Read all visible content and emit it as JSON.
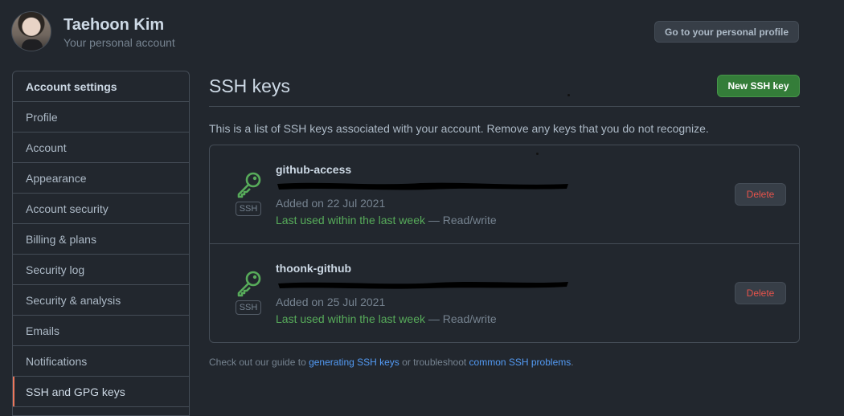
{
  "header": {
    "user_name": "Taehoon Kim",
    "account_label": "Your personal account",
    "profile_button": "Go to your personal profile"
  },
  "sidebar": {
    "items": [
      {
        "label": "Account settings"
      },
      {
        "label": "Profile"
      },
      {
        "label": "Account"
      },
      {
        "label": "Appearance"
      },
      {
        "label": "Account security"
      },
      {
        "label": "Billing & plans"
      },
      {
        "label": "Security log"
      },
      {
        "label": "Security & analysis"
      },
      {
        "label": "Emails"
      },
      {
        "label": "Notifications"
      },
      {
        "label": "SSH and GPG keys"
      }
    ]
  },
  "main": {
    "title": "SSH keys",
    "new_key_button": "New SSH key",
    "intro": "This is a list of SSH keys associated with your account. Remove any keys that you do not recognize.",
    "keys": [
      {
        "badge": "SSH",
        "title": "github-access",
        "added": "Added on 22 Jul 2021",
        "last_used": "Last used within the last week",
        "access": " — Read/write",
        "delete_label": "Delete"
      },
      {
        "badge": "SSH",
        "title": "thoonk-github",
        "added": "Added on 25 Jul 2021",
        "last_used": "Last used within the last week",
        "access": " — Read/write",
        "delete_label": "Delete"
      }
    ],
    "guide": {
      "prefix": "Check out our guide to ",
      "link1": "generating SSH keys",
      "middle": " or troubleshoot ",
      "link2": "common SSH problems",
      "suffix": "."
    }
  },
  "colors": {
    "background": "#22272e",
    "border": "#444c56",
    "primary_button": "#347d39",
    "success_text": "#57ab5a",
    "danger_text": "#e5534b",
    "link": "#539bf5",
    "active_indicator": "#ec775c"
  },
  "icons": [
    "key-icon",
    "avatar"
  ]
}
